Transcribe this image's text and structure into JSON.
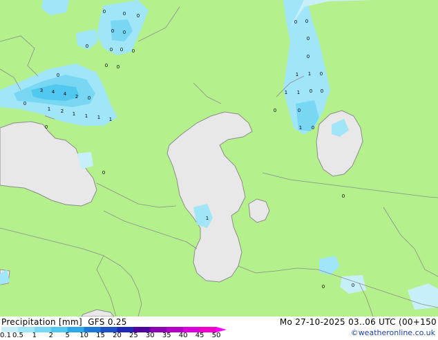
{
  "header": {
    "product": "Precipitation [mm]",
    "model": "GFS 0.25",
    "valid_time": "Mo 27-10-2025 03..06 UTC (00+150"
  },
  "credit": "©weatheronline.co.uk",
  "legend": {
    "ticks": [
      "0.1",
      "0.5",
      "1",
      "2",
      "5",
      "10",
      "15",
      "20",
      "25",
      "30",
      "35",
      "40",
      "45",
      "50"
    ],
    "colors": [
      "#c8f0fa",
      "#a0e6f8",
      "#78d8f4",
      "#50c8f0",
      "#2aa8e8",
      "#1e78d8",
      "#1e50c8",
      "#1e28b4",
      "#5000a0",
      "#8c00b4",
      "#b400c8",
      "#dc00dc",
      "#f000c8",
      "#ff00ff"
    ]
  },
  "colors": {
    "land": "#b4f08c",
    "sea": "#e8e8e8",
    "border": "#8c8c8c",
    "coast": "#8c8c8c"
  },
  "values": [
    "0",
    "0",
    "0",
    "0",
    "0",
    "0",
    "0",
    "0",
    "0",
    "0",
    "0",
    "0",
    "3",
    "4",
    "4",
    "2",
    "0",
    "1",
    "2",
    "1",
    "1",
    "1",
    "1",
    "0",
    "0",
    "0",
    "0",
    "0",
    "0",
    "0",
    "1",
    "1",
    "0",
    "1",
    "1",
    "0",
    "0",
    "0",
    "1",
    "0",
    "0",
    "0",
    "1",
    "0",
    "0"
  ]
}
